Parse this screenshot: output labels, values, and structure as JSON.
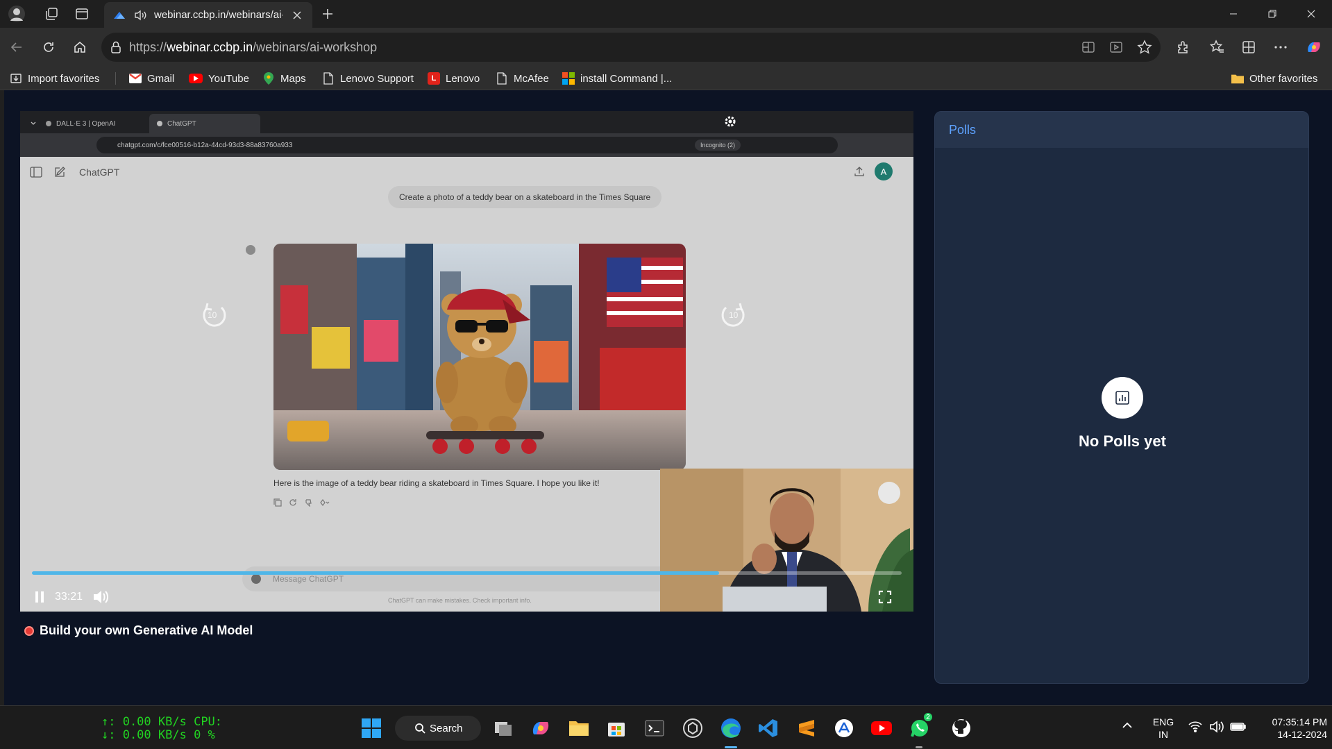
{
  "browser": {
    "tab": {
      "title": "webinar.ccbp.in/webinars/ai-workshop"
    },
    "url": {
      "scheme": "https://",
      "host": "webinar.ccbp.in",
      "path": "/webinars/ai-workshop"
    }
  },
  "bookmarks": [
    {
      "label": "Import favorites",
      "icon": "import-icon"
    },
    {
      "label": "Gmail",
      "icon": "gmail-icon"
    },
    {
      "label": "YouTube",
      "icon": "youtube-icon"
    },
    {
      "label": "Maps",
      "icon": "maps-icon"
    },
    {
      "label": "Lenovo Support",
      "icon": "page-icon"
    },
    {
      "label": "Lenovo",
      "icon": "lenovo-icon"
    },
    {
      "label": "McAfee",
      "icon": "page-icon"
    },
    {
      "label": "install Command |...",
      "icon": "microsoft-icon"
    }
  ],
  "other_favorites": "Other favorites",
  "video": {
    "inner_tabs": [
      "DALL·E 3 | OpenAI",
      "ChatGPT"
    ],
    "inner_url": "chatgpt.com/c/fce00516-b12a-44cd-93d3-88a83760a933",
    "incognito": "Incognito (2)",
    "chat_title": "ChatGPT",
    "avatar_letter": "A",
    "user_prompt": "Create a photo of a teddy bear on a skateboard in the Times Square",
    "assistant_reply": "Here is the image of a teddy bear riding a skateboard in Times Square. I hope you like it!",
    "input_placeholder": "Message ChatGPT",
    "disclaimer": "ChatGPT can make mistakes. Check important info.",
    "rewind_label": "10",
    "forward_label": "10",
    "time": "33:21",
    "progress": 0.79
  },
  "webinar_title": "Build your own Generative AI Model",
  "polls": {
    "header": "Polls",
    "empty_text": "No Polls yet"
  },
  "taskbar": {
    "net_up": "↑:   0.00 KB/s",
    "net_down": "↓:   0.00 KB/s",
    "cpu_label": "CPU:",
    "cpu_value": "0 %",
    "search_label": "Search",
    "whatsapp_badge": "2",
    "lang_top": "ENG",
    "lang_bottom": "IN",
    "clock_time": "07:35:14 PM",
    "clock_date": "14-12-2024"
  },
  "colors": {
    "accent_blue": "#5ea2ff",
    "progress": "#4fb6e8",
    "live_red": "#e53935",
    "net_green": "#21d321"
  }
}
